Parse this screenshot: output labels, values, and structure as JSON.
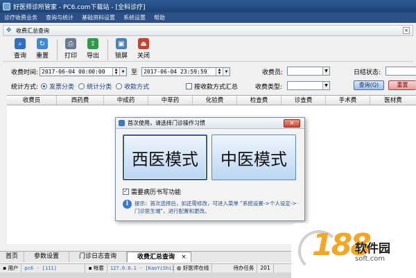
{
  "window": {
    "title": "好医师诊所管家 - PC6.com下载站 - [全科诊疗]"
  },
  "menu": [
    "诊疗收费业务",
    "查询与统计",
    "基础资料设置",
    "系统设置",
    "帮助"
  ],
  "panel": {
    "title": "收费汇总查询",
    "close": "×"
  },
  "toolbar": {
    "query": "查询",
    "reset": "重置",
    "print": "打印",
    "export": "导出",
    "lock": "锁屏",
    "close": "关闭"
  },
  "filters": {
    "time_label": "收费时间:",
    "start": "2017-06-04 00:00:00",
    "to": "至",
    "end": "2017-06-04 23:59:59",
    "cashier_label": "收费员:",
    "cashier_value": "",
    "settle_label": "日结状态:",
    "stat_label": "统计方式:",
    "opt1": "发票分类",
    "opt2": "统计分类",
    "opt3": "收款方式",
    "group_label": "按收款方式汇总",
    "fee_type_label": "收费类型:",
    "fee_type_value": "",
    "query_btn": "查询(Q)",
    "reset_btn": "重置"
  },
  "grid": {
    "columns": [
      "收费员",
      "西药费",
      "中成药",
      "中草药",
      "化验费",
      "检查费",
      "诊查费",
      "手术费",
      "医材费"
    ]
  },
  "tabs": [
    "首页",
    "参数设置",
    "门诊日志查询",
    "收费汇总查询"
  ],
  "tab_close": "×",
  "status": {
    "user_label": "用户",
    "user_value": "pc6 - [111]",
    "account_label": "帐套",
    "account_value": "127.0.0.1 - [KaoYiShi]",
    "online": "好医师在线",
    "pending": "待办任务",
    "year": "201"
  },
  "dialog": {
    "title": "首次使用，请选择门诊操作习惯",
    "close": "×",
    "western": "西医模式",
    "chinese": "中医模式",
    "need_record": "需要病历书写功能",
    "tip": "提示：首次选择后，如还需修改，可进入菜单 \"系统设置->个人设定->门诊医生端\"，进行配置和更改。"
  },
  "watermark": {
    "num": "188",
    "name": "软件园",
    "url": "soft.com"
  },
  "colors": {
    "accent": "#2c4f86",
    "selected_border": "#2b5fa8"
  }
}
